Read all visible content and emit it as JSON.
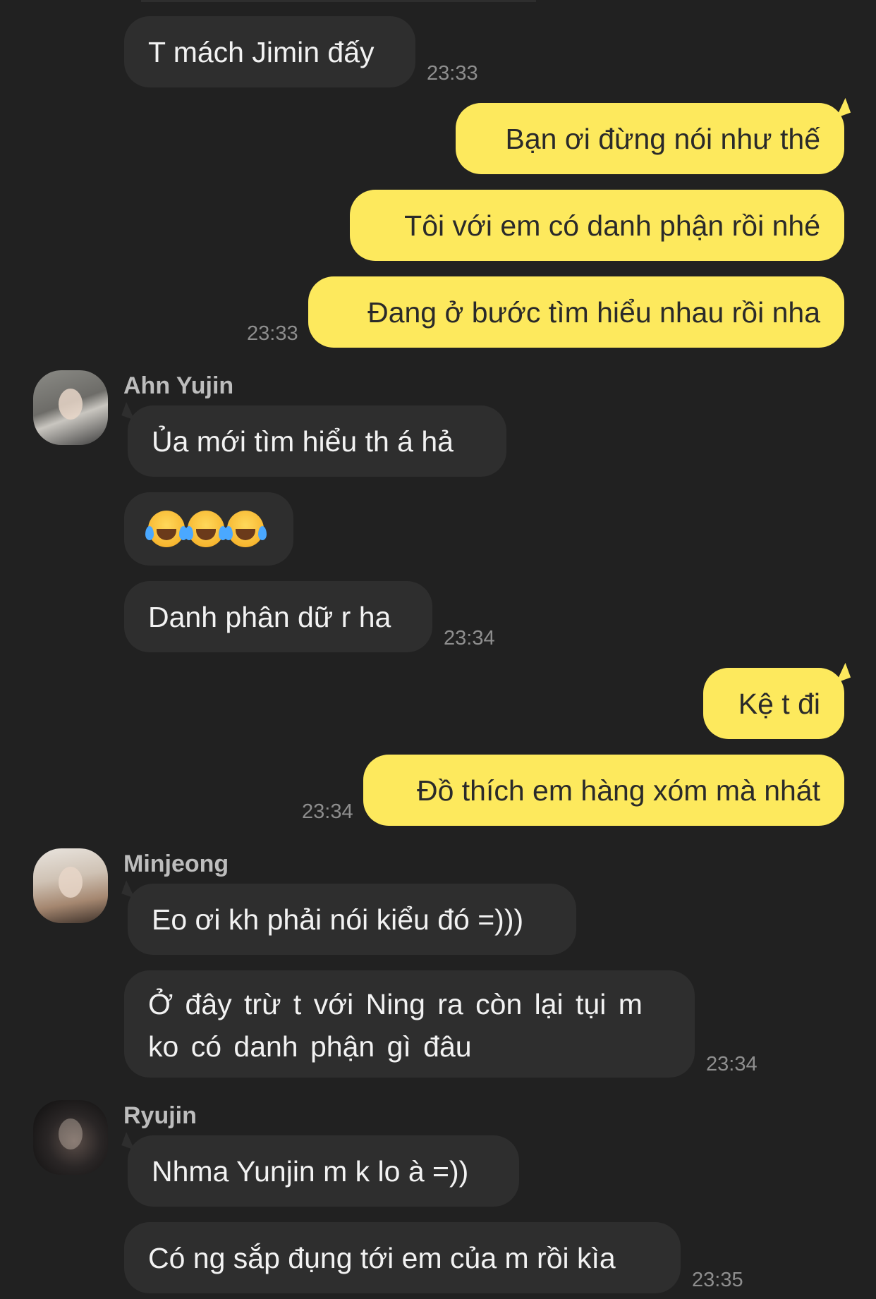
{
  "messages": [
    {
      "text": "T mách Jimin đấy",
      "time": "23:33"
    },
    {
      "text": "Bạn ơi đừng nói như thế"
    },
    {
      "text": "Tôi với em có danh phận rồi nhé"
    },
    {
      "text": "Đang ở bước tìm hiểu nhau rồi nha",
      "time": "23:33"
    },
    {
      "sender": "Ahn Yujin",
      "avatar_icon": "profile-photo",
      "text": "Ủa mới tìm hiểu th á hả"
    },
    {
      "emoji": [
        "face-with-tears-of-joy",
        "face-with-tears-of-joy",
        "face-with-tears-of-joy"
      ]
    },
    {
      "text": "Danh phân dữ r ha",
      "time": "23:34"
    },
    {
      "text": "Kệ t đi"
    },
    {
      "text": "Đồ thích em hàng xóm mà nhát",
      "time": "23:34"
    },
    {
      "sender": "Minjeong",
      "avatar_icon": "profile-photo",
      "text": "Eo ơi kh phải nói kiểu đó =)))"
    },
    {
      "text": "Ở đây trừ t với Ning ra còn lại tụi m ko có danh phận gì đâu",
      "time": "23:34"
    },
    {
      "sender": "Ryujin",
      "avatar_icon": "profile-photo",
      "text": "Nhma Yunjin m k lo à =))"
    },
    {
      "text": "Có ng sắp đụng tới em của m rồi kìa",
      "time": "23:35"
    }
  ],
  "colors": {
    "background": "#212121",
    "incoming_bubble": "#2e2e2e",
    "outgoing_bubble": "#fde95d",
    "timestamp": "#8e8e8e"
  }
}
